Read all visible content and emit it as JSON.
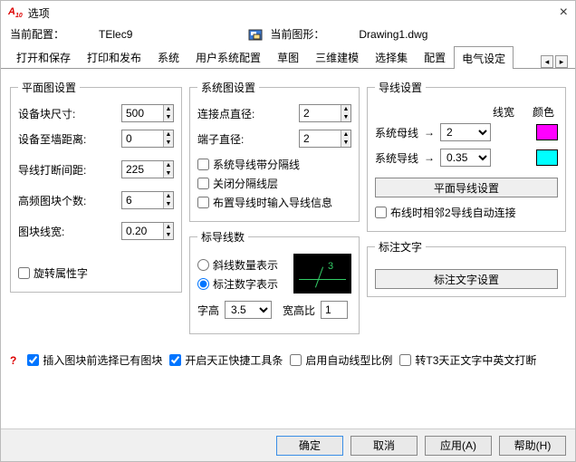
{
  "window": {
    "title": "选项"
  },
  "info": {
    "current_config_label": "当前配置：",
    "current_config_value": "TElec9",
    "current_drawing_label": "当前图形：",
    "current_drawing_value": "Drawing1.dwg"
  },
  "tabs": {
    "items": [
      "打开和保存",
      "打印和发布",
      "系统",
      "用户系统配置",
      "草图",
      "三维建模",
      "选择集",
      "配置",
      "电气设定"
    ],
    "active_index": 8
  },
  "plan": {
    "legend": "平面图设置",
    "block_size_label": "设备块尺寸:",
    "block_size_value": "500",
    "wall_dist_label": "设备至墙距离:",
    "wall_dist_value": "0",
    "break_gap_label": "导线打断间距:",
    "break_gap_value": "225",
    "hf_count_label": "高频图块个数:",
    "hf_count_value": "6",
    "block_linewidth_label": "图块线宽:",
    "block_linewidth_value": "0.20",
    "rotate_attr_label": "旋转属性字"
  },
  "system": {
    "legend": "系统图设置",
    "conn_diam_label": "连接点直径:",
    "conn_diam_value": "2",
    "term_diam_label": "端子直径:",
    "term_diam_value": "2",
    "sys_wire_sep_label": "系统导线带分隔线",
    "close_sep_layer_label": "关闭分隔线层",
    "output_wire_info_label": "布置导线时输入导线信息"
  },
  "markcount": {
    "legend": "标导线数",
    "slash_mode_label": "斜线数量表示",
    "number_mode_label": "标注数字表示",
    "preview_num": "3",
    "font_h_label": "字高",
    "font_h_value": "3.5",
    "aspect_label": "宽高比",
    "aspect_value": "1"
  },
  "wire": {
    "legend": "导线设置",
    "linewidth_header": "线宽",
    "color_header": "颜色",
    "bus_label": "系统母线",
    "bus_width": "2",
    "bus_color": "#ff00ff",
    "line_label": "系统导线",
    "line_width_options": [
      "0.35"
    ],
    "line_width": "0.35",
    "line_color": "#00ffff",
    "plan_wire_btn": "平面导线设置",
    "auto_connect_label": "布线时相邻2导线自动连接"
  },
  "marktext": {
    "legend": "标注文字",
    "btn": "标注文字设置"
  },
  "bottom": {
    "q": "?",
    "c1": "插入图块前选择已有图块",
    "c2": "开启天正快捷工具条",
    "c3": "启用自动线型比例",
    "c4": "转T3天正文字中英文打断"
  },
  "buttons": {
    "ok": "确定",
    "cancel": "取消",
    "apply": "应用(A)",
    "help": "帮助(H)"
  }
}
